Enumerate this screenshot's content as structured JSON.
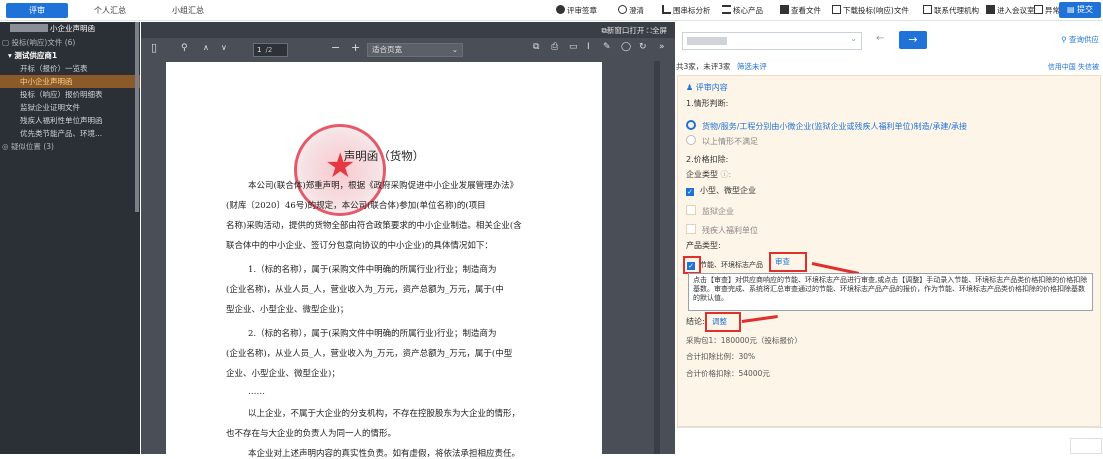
{
  "tabs": [
    "评审",
    "个人汇总",
    "小组汇总"
  ],
  "tools": [
    "评审签章",
    "澄清",
    "围串标分析",
    "核心产品",
    "查看文件",
    "下载投标(响应)文件",
    "联系代理机构",
    "进入会议室",
    "异常处理",
    "刷新"
  ],
  "submit_label": "提交",
  "left": {
    "header": "小企业声明函",
    "group1": "投标(响应)文件 (6)",
    "supplier": "测试供应商1",
    "items": [
      "开标（报价）一览表",
      "中小企业声明函",
      "投标（响应）报价明细表",
      "监狱企业证明文件",
      "残疾人福利性单位声明函",
      "优先类节能产品、环境..."
    ],
    "group2": "疑似位置 (3)"
  },
  "viewer": {
    "newwin": "新窗口打开",
    "fullscreen": "全屏",
    "page": "1",
    "pages": "/2",
    "zoom": "适合页宽"
  },
  "doc": {
    "title": "声明函（货物）",
    "lines": [
      "本公司(联合体)郑重声明，根据《政府采购促进中小企业发展管理办法》",
      "(财库〔2020〕46号)的规定，本公司(联合体)参加(单位名称)的(项目",
      "名称)采购活动，提供的货物全部由符合政策要求的中小企业制造。相关企业(含",
      "联合体中的中小企业、签订分包意向协议的中小企业)的具体情况如下：",
      "1.（标的名称），属于(采购文件中明确的所属行业)行业；制造商为",
      "(企业名称)，从业人员_人，营业收入为_万元，资产总额为_万元，属于(中",
      "型企业、小型企业、微型企业)；",
      "2.（标的名称），属于(采购文件中明确的所属行业)行业；制造商为",
      "(企业名称)，从业人员_人，营业收入为_万元，资产总额为_万元，属于(中型",
      "企业、小型企业、微型企业)；",
      "……",
      "以上企业，不属于大企业的分支机构，不存在控股股东为大企业的情形，",
      "也不存在与大企业的负责人为同一人的情形。",
      "本企业对上述声明内容的真实性负责。如有虚假，将依法承担相应责任。"
    ]
  },
  "right": {
    "query_link": "查询供应",
    "count_text": "共3家，未评3家",
    "filter_link": "筛选未评",
    "credit_links": "信用中国 失信被",
    "section_title": "评审内容",
    "q1": "1.情形判断:",
    "opt1": "货物/服务/工程分别由小微企业(监狱企业或残疾人福利单位)制造/承建/承接",
    "opt2": "以上情形不满足",
    "q2": "2.价格扣除:",
    "ent_type_label": "企业类型",
    "ent_types": [
      "小型、微型企业",
      "监狱企业",
      "残疾人福利单位"
    ],
    "prod_type_label": "产品类型:",
    "prod_type": "节能、环境标志产品",
    "review_btn": "审查",
    "tip": "点击【审查】对供应商响应的节能、环境标志产品进行审查,或点击【调整】手动录入节能、环境标志产品类价格扣除的价格扣除基数。审查完成、系统将汇总审查通过的节能、环境标志产品产品的报价，作为节能、环境标志产品类价格扣除的价格扣除基数的默认值。",
    "conclusion_label": "结论:",
    "adjust_btn": "调整",
    "pack": "采购包1：180000元（投标报价）",
    "ratio": "合计扣除比例：30%",
    "amount": "合计价格扣除：54000元"
  }
}
